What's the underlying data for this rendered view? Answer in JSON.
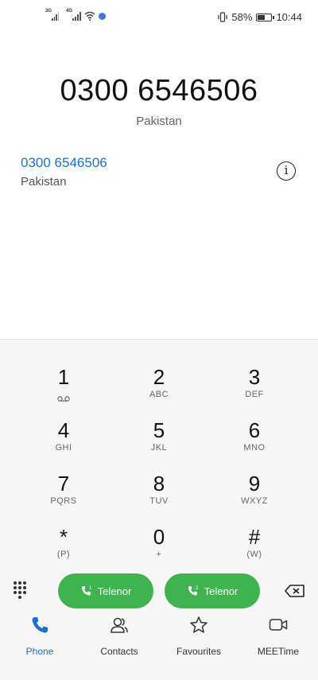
{
  "status_bar": {
    "sim1_tag": "3G",
    "sim2_tag": "4G",
    "battery_percent_text": "58%",
    "battery_level": 0.58,
    "time": "10:44"
  },
  "number_entry": {
    "number": "0300 6546506",
    "country": "Pakistan"
  },
  "suggestion": {
    "number": "0300 6546506",
    "country": "Pakistan",
    "info_icon": "info-icon"
  },
  "dialpad": {
    "keys": [
      {
        "digit": "1",
        "letters": ""
      },
      {
        "digit": "2",
        "letters": "ABC"
      },
      {
        "digit": "3",
        "letters": "DEF"
      },
      {
        "digit": "4",
        "letters": "GHI"
      },
      {
        "digit": "5",
        "letters": "JKL"
      },
      {
        "digit": "6",
        "letters": "MNO"
      },
      {
        "digit": "7",
        "letters": "PQRS"
      },
      {
        "digit": "8",
        "letters": "TUV"
      },
      {
        "digit": "9",
        "letters": "WXYZ"
      },
      {
        "digit": "*",
        "letters": "(P)"
      },
      {
        "digit": "0",
        "letters": "+"
      },
      {
        "digit": "#",
        "letters": "(W)"
      }
    ]
  },
  "actions": {
    "call1_label": "Telenor",
    "call1_sim": "1",
    "call2_label": "Telenor",
    "call2_sim": "2",
    "call_color": "#3fb34f"
  },
  "nav": {
    "items": [
      {
        "label": "Phone",
        "icon": "phone-icon",
        "active": true
      },
      {
        "label": "Contacts",
        "icon": "contacts-icon",
        "active": false
      },
      {
        "label": "Favourites",
        "icon": "star-icon",
        "active": false
      },
      {
        "label": "MEETime",
        "icon": "video-call-icon",
        "active": false
      }
    ],
    "active_color": "#1a6fd4"
  }
}
